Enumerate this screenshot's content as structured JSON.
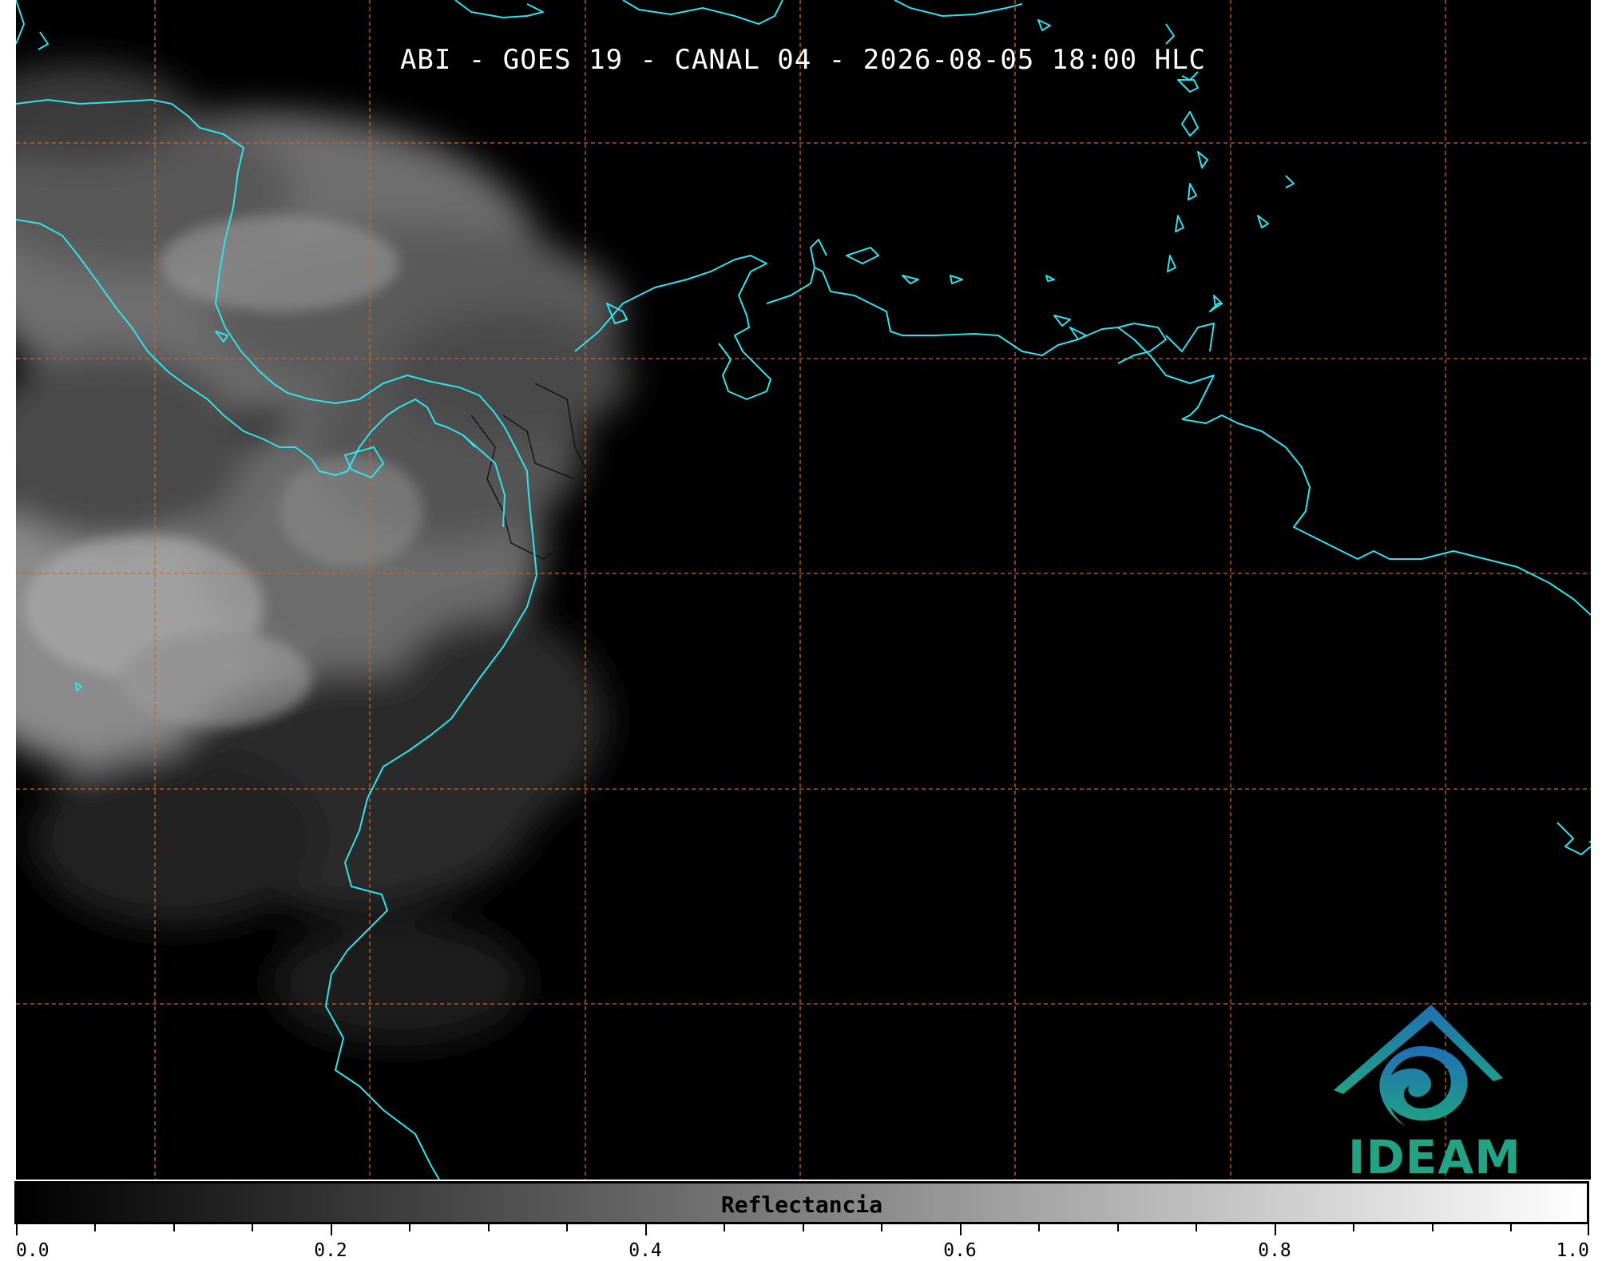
{
  "title": "ABI - GOES 19 - CANAL 04 - 2026-08-05 18:00 HLC",
  "colorbar": {
    "label": "Reflectancia",
    "ticks": [
      "0.0",
      "0.2",
      "0.4",
      "0.6",
      "0.8",
      "1.0"
    ],
    "range": [
      0.0,
      1.0
    ],
    "colors": [
      "#000000",
      "#ffffff"
    ]
  },
  "logo": {
    "text": "IDEAM"
  },
  "colors": {
    "coastline": "#2fe3ee",
    "gridlines": "#d0661e",
    "background": "#000000",
    "brand_blue": "#1f6fb5",
    "brand_green": "#21a384"
  }
}
